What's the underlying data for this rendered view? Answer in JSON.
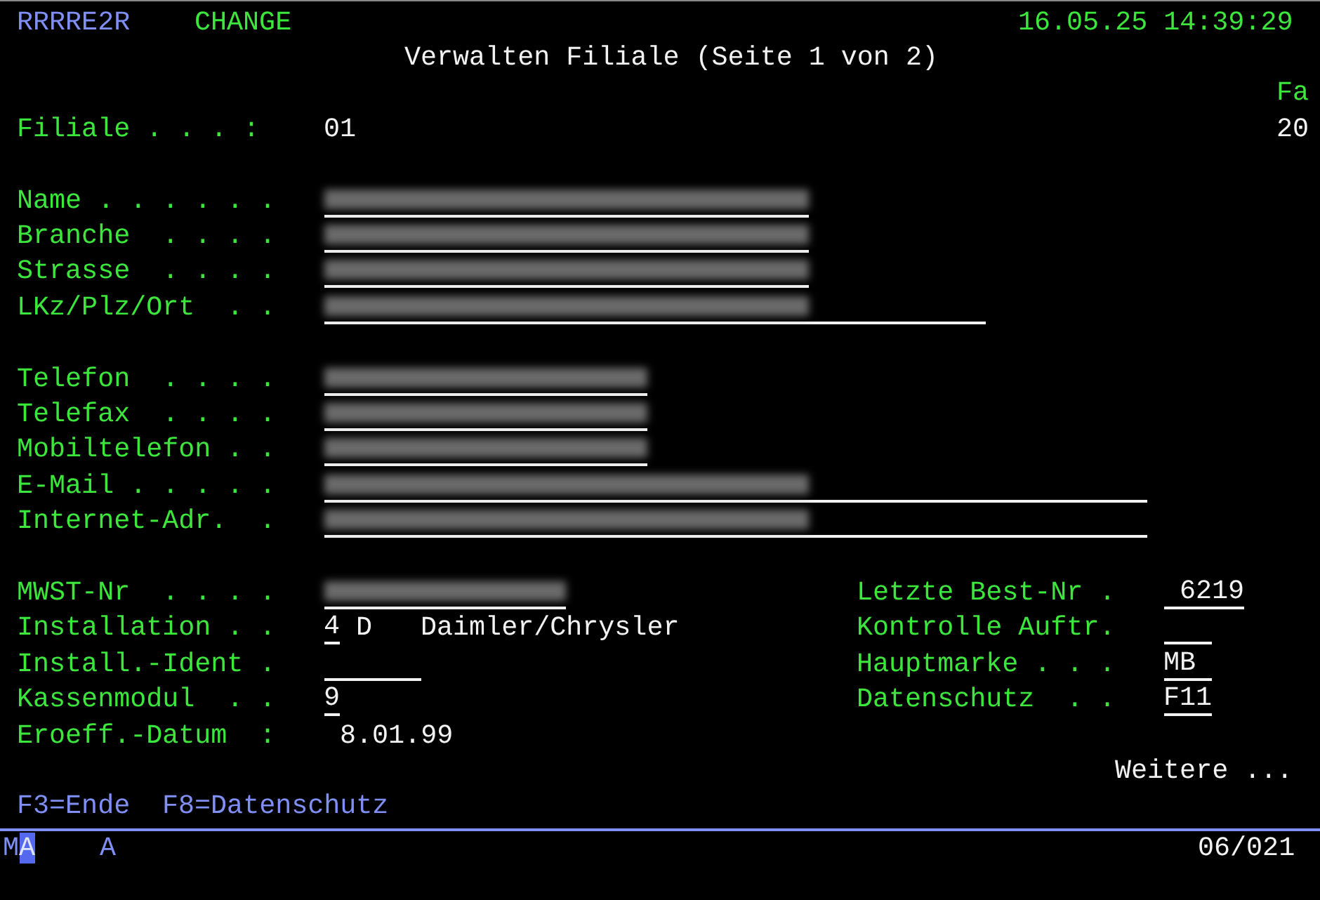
{
  "header": {
    "program": "RRRRE2R",
    "mode": "CHANGE",
    "datetime": "16.05.25 14:39:29",
    "title": "Verwalten Filiale (Seite 1 von 2)",
    "corner_label": "Fa",
    "corner_value": "20"
  },
  "filiale": {
    "label": "Filiale . . . :",
    "value": "01"
  },
  "address_fields": [
    {
      "label": "Name . . . . . .",
      "obscured": true
    },
    {
      "label": "Branche  . . . .",
      "obscured": true
    },
    {
      "label": "Strasse  . . . .",
      "obscured": true
    },
    {
      "label": "LKz/Plz/Ort  . .",
      "obscured": true
    }
  ],
  "contact_fields": [
    {
      "label": "Telefon  . . . .",
      "obscured": true
    },
    {
      "label": "Telefax  . . . .",
      "obscured": true
    },
    {
      "label": "Mobiltelefon . .",
      "obscured": true
    },
    {
      "label": "E-Mail . . . . .",
      "obscured": true
    },
    {
      "label": "Internet-Adr.  .",
      "obscured": true
    }
  ],
  "lower_fields": [
    {
      "label": "MWST-Nr  . . . .",
      "obscured": true
    },
    {
      "label": "Installation . .",
      "value": "4",
      "suffix": "D",
      "description": "Daimler/Chrysler"
    },
    {
      "label": "Install.-Ident ."
    },
    {
      "label": "Kassenmodul  . .",
      "value": "9"
    },
    {
      "label": "Eroeff.-Datum  :",
      "output": "8.01.99"
    }
  ],
  "right_fields": [
    {
      "label": "Letzte Best-Nr .",
      "value": " 6219"
    },
    {
      "label": "Kontrolle Auftr."
    },
    {
      "label": "Hauptmarke . . .",
      "value": "MB"
    },
    {
      "label": "Datenschutz  . .",
      "value": "F11"
    }
  ],
  "more_text": "Weitere ...",
  "function_keys": [
    "F3=Ende",
    "F8=Datenschutz"
  ],
  "status": {
    "prefix": "M",
    "cursor_char": "A",
    "indicator": "A",
    "position": "06/021"
  }
}
